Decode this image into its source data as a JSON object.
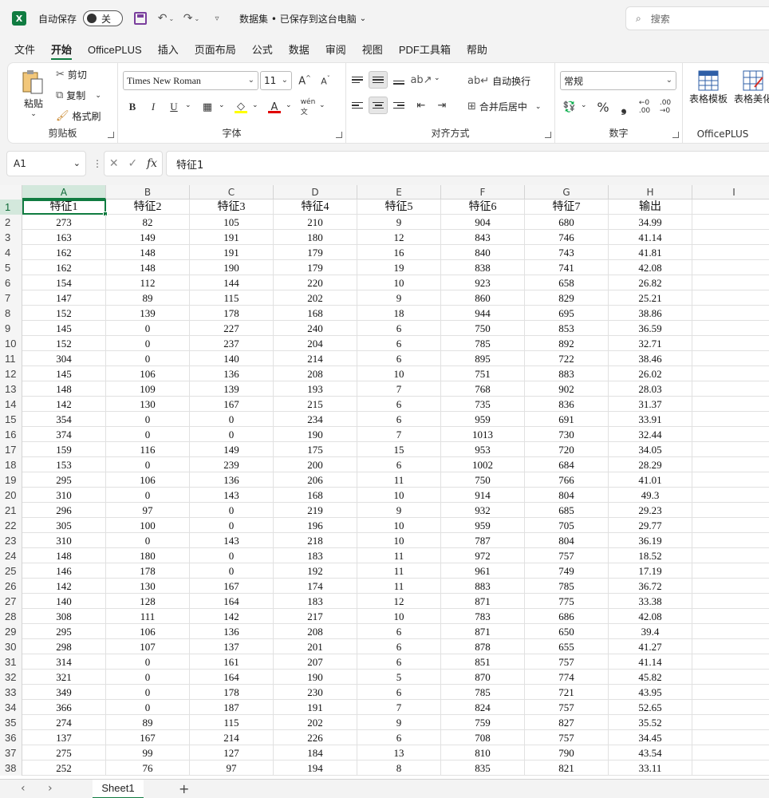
{
  "titlebar": {
    "app_icon": "excel-icon",
    "autosave_label": "自动保存",
    "autosave_state": "关",
    "doc_title": "数据集 • 已保存到这台电脑",
    "search_placeholder": "搜索"
  },
  "menu": {
    "tabs": [
      "文件",
      "开始",
      "OfficePLUS",
      "插入",
      "页面布局",
      "公式",
      "数据",
      "审阅",
      "视图",
      "PDF工具箱",
      "帮助"
    ],
    "active": "开始"
  },
  "ribbon": {
    "clipboard": {
      "paste": "粘贴",
      "cut": "剪切",
      "copy": "复制",
      "format_painter": "格式刷",
      "label": "剪贴板"
    },
    "font": {
      "name": "Times New Roman",
      "size": "11",
      "bold": "B",
      "italic": "I",
      "underline": "U",
      "label": "字体"
    },
    "align": {
      "wrap": "自动换行",
      "merge": "合并后居中",
      "label": "对齐方式"
    },
    "number": {
      "format": "常规",
      "percent": "%",
      "comma": "❟",
      "label": "数字"
    },
    "officeplus": {
      "template": "表格模板",
      "beautify": "表格美化",
      "label": "OfficePLUS"
    }
  },
  "formula": {
    "cell_ref": "A1",
    "content": "特征1"
  },
  "sheet": {
    "columns": [
      "A",
      "B",
      "C",
      "D",
      "E",
      "F",
      "G",
      "H",
      "I"
    ],
    "headers": [
      "特征1",
      "特征2",
      "特征3",
      "特征4",
      "特征5",
      "特征6",
      "特征7",
      "输出"
    ],
    "rows": [
      [
        "273",
        "82",
        "105",
        "210",
        "9",
        "904",
        "680",
        "34.99"
      ],
      [
        "163",
        "149",
        "191",
        "180",
        "12",
        "843",
        "746",
        "41.14"
      ],
      [
        "162",
        "148",
        "191",
        "179",
        "16",
        "840",
        "743",
        "41.81"
      ],
      [
        "162",
        "148",
        "190",
        "179",
        "19",
        "838",
        "741",
        "42.08"
      ],
      [
        "154",
        "112",
        "144",
        "220",
        "10",
        "923",
        "658",
        "26.82"
      ],
      [
        "147",
        "89",
        "115",
        "202",
        "9",
        "860",
        "829",
        "25.21"
      ],
      [
        "152",
        "139",
        "178",
        "168",
        "18",
        "944",
        "695",
        "38.86"
      ],
      [
        "145",
        "0",
        "227",
        "240",
        "6",
        "750",
        "853",
        "36.59"
      ],
      [
        "152",
        "0",
        "237",
        "204",
        "6",
        "785",
        "892",
        "32.71"
      ],
      [
        "304",
        "0",
        "140",
        "214",
        "6",
        "895",
        "722",
        "38.46"
      ],
      [
        "145",
        "106",
        "136",
        "208",
        "10",
        "751",
        "883",
        "26.02"
      ],
      [
        "148",
        "109",
        "139",
        "193",
        "7",
        "768",
        "902",
        "28.03"
      ],
      [
        "142",
        "130",
        "167",
        "215",
        "6",
        "735",
        "836",
        "31.37"
      ],
      [
        "354",
        "0",
        "0",
        "234",
        "6",
        "959",
        "691",
        "33.91"
      ],
      [
        "374",
        "0",
        "0",
        "190",
        "7",
        "1013",
        "730",
        "32.44"
      ],
      [
        "159",
        "116",
        "149",
        "175",
        "15",
        "953",
        "720",
        "34.05"
      ],
      [
        "153",
        "0",
        "239",
        "200",
        "6",
        "1002",
        "684",
        "28.29"
      ],
      [
        "295",
        "106",
        "136",
        "206",
        "11",
        "750",
        "766",
        "41.01"
      ],
      [
        "310",
        "0",
        "143",
        "168",
        "10",
        "914",
        "804",
        "49.3"
      ],
      [
        "296",
        "97",
        "0",
        "219",
        "9",
        "932",
        "685",
        "29.23"
      ],
      [
        "305",
        "100",
        "0",
        "196",
        "10",
        "959",
        "705",
        "29.77"
      ],
      [
        "310",
        "0",
        "143",
        "218",
        "10",
        "787",
        "804",
        "36.19"
      ],
      [
        "148",
        "180",
        "0",
        "183",
        "11",
        "972",
        "757",
        "18.52"
      ],
      [
        "146",
        "178",
        "0",
        "192",
        "11",
        "961",
        "749",
        "17.19"
      ],
      [
        "142",
        "130",
        "167",
        "174",
        "11",
        "883",
        "785",
        "36.72"
      ],
      [
        "140",
        "128",
        "164",
        "183",
        "12",
        "871",
        "775",
        "33.38"
      ],
      [
        "308",
        "111",
        "142",
        "217",
        "10",
        "783",
        "686",
        "42.08"
      ],
      [
        "295",
        "106",
        "136",
        "208",
        "6",
        "871",
        "650",
        "39.4"
      ],
      [
        "298",
        "107",
        "137",
        "201",
        "6",
        "878",
        "655",
        "41.27"
      ],
      [
        "314",
        "0",
        "161",
        "207",
        "6",
        "851",
        "757",
        "41.14"
      ],
      [
        "321",
        "0",
        "164",
        "190",
        "5",
        "870",
        "774",
        "45.82"
      ],
      [
        "349",
        "0",
        "178",
        "230",
        "6",
        "785",
        "721",
        "43.95"
      ],
      [
        "366",
        "0",
        "187",
        "191",
        "7",
        "824",
        "757",
        "52.65"
      ],
      [
        "274",
        "89",
        "115",
        "202",
        "9",
        "759",
        "827",
        "35.52"
      ],
      [
        "137",
        "167",
        "214",
        "226",
        "6",
        "708",
        "757",
        "34.45"
      ],
      [
        "275",
        "99",
        "127",
        "184",
        "13",
        "810",
        "790",
        "43.54"
      ],
      [
        "252",
        "76",
        "97",
        "194",
        "8",
        "835",
        "821",
        "33.11"
      ]
    ],
    "tab_name": "Sheet1",
    "add_sheet": "+"
  }
}
